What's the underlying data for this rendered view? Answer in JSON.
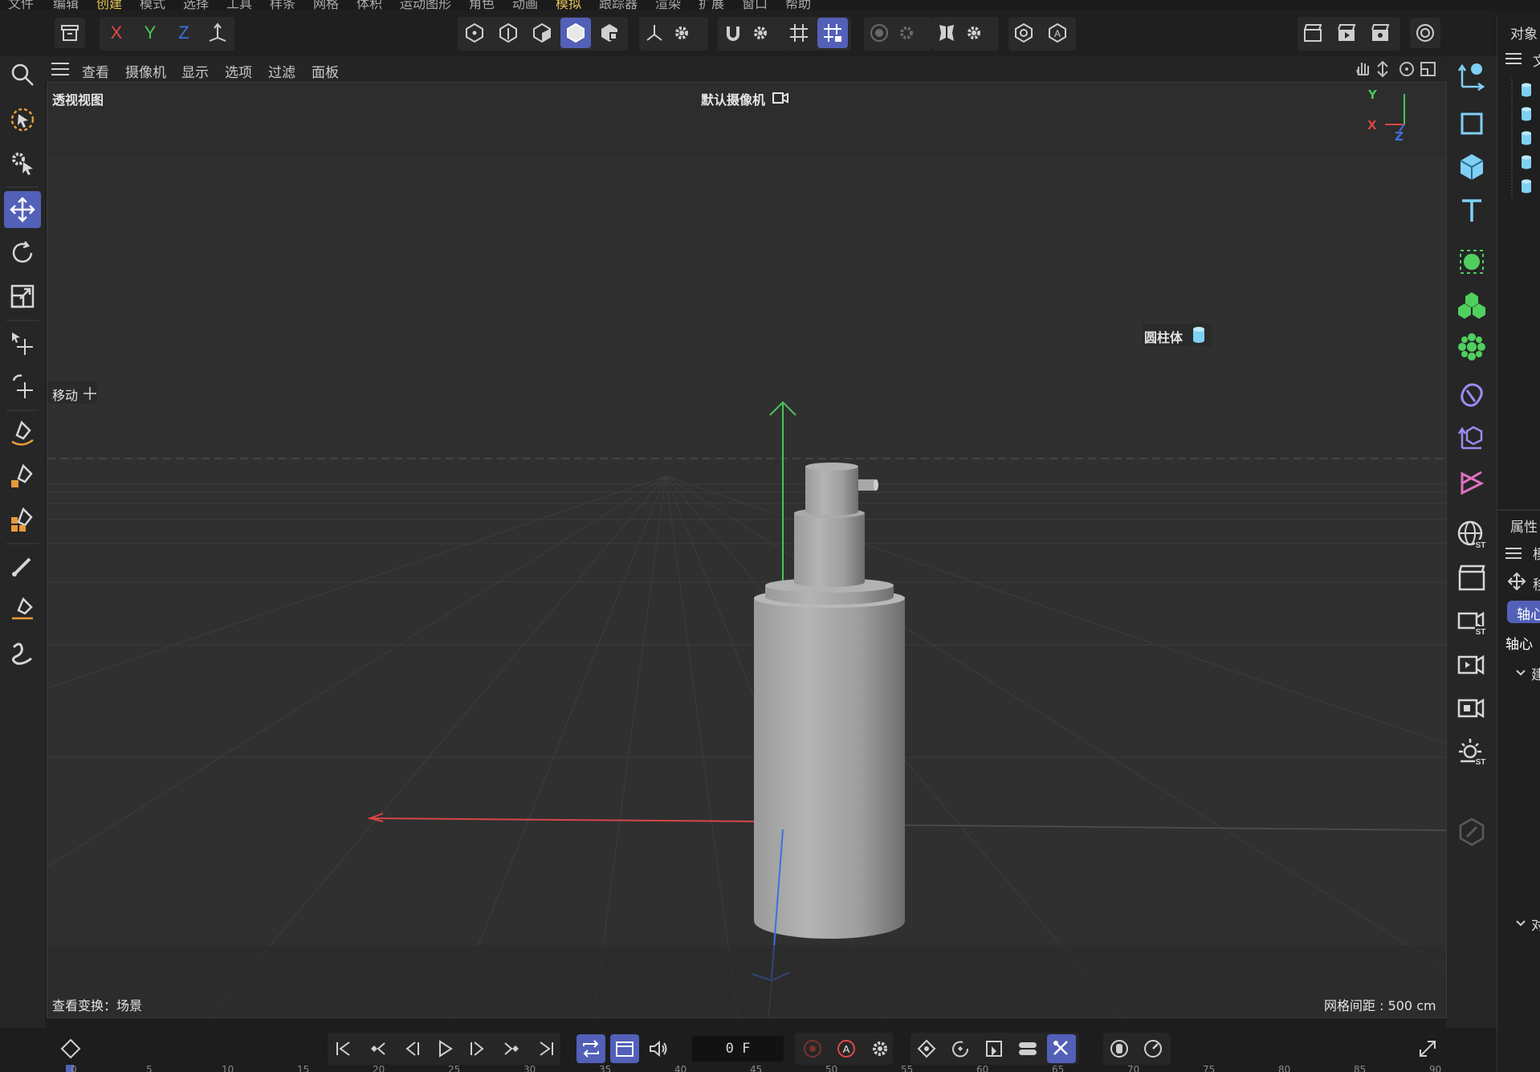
{
  "menubar": {
    "items": [
      {
        "label": "文件",
        "highlight": false
      },
      {
        "label": "编辑",
        "highlight": false
      },
      {
        "label": "创建",
        "highlight": true
      },
      {
        "label": "模式",
        "highlight": false
      },
      {
        "label": "选择",
        "highlight": false
      },
      {
        "label": "工具",
        "highlight": false
      },
      {
        "label": "样条",
        "highlight": false
      },
      {
        "label": "网格",
        "highlight": false
      },
      {
        "label": "体积",
        "highlight": false
      },
      {
        "label": "运动图形",
        "highlight": false
      },
      {
        "label": "角色",
        "highlight": false
      },
      {
        "label": "动画",
        "highlight": false
      },
      {
        "label": "模拟",
        "highlight": true
      },
      {
        "label": "跟踪器",
        "highlight": false
      },
      {
        "label": "渲染",
        "highlight": false
      },
      {
        "label": "扩展",
        "highlight": false
      },
      {
        "label": "窗口",
        "highlight": false
      },
      {
        "label": "帮助",
        "highlight": false
      }
    ]
  },
  "toolbar": {
    "axis_x": "X",
    "axis_y": "Y",
    "axis_z": "Z"
  },
  "viewport_menu": {
    "items": [
      "查看",
      "摄像机",
      "显示",
      "选项",
      "过滤",
      "面板"
    ]
  },
  "viewport": {
    "view_name": "透视视图",
    "camera": "默认摄像机",
    "tool_label": "移动",
    "object_label": "圆柱体",
    "axis_y": "Y",
    "axis_x": "X",
    "axis_z": "Z",
    "view_transform": "查看变换：场景",
    "grid_spacing": "网格间距 : 500 cm"
  },
  "right_panel": {
    "objects_title": "对象",
    "objects_tab": "文",
    "attributes_title": "属性",
    "attr_menu": "模",
    "attr_mode": "移",
    "axis_badge": "轴心",
    "axis_label": "轴心",
    "section1": "建",
    "section2": "对"
  },
  "timeline": {
    "current_frame": "0 F",
    "ruler_labels": [
      "0",
      "5",
      "10",
      "15",
      "20",
      "25",
      "30",
      "35",
      "40",
      "45",
      "50",
      "55",
      "60",
      "65",
      "70",
      "75",
      "80",
      "85",
      "90"
    ]
  },
  "colors": {
    "accent": "#5260b8",
    "axis_x": "#e04848",
    "axis_y": "#49c65a",
    "axis_z": "#3f6fe0",
    "menu_highlight": "#e6c356",
    "object_icon": "#7fd0f5"
  }
}
